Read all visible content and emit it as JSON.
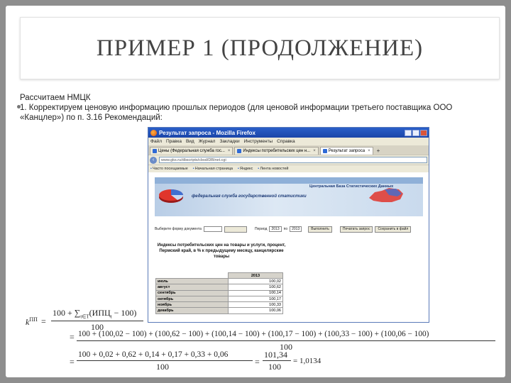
{
  "slide": {
    "title": "ПРИМЕР 1 (ПРОДОЛЖЕНИЕ)",
    "line1": "Рассчитаем НМЦК",
    "line2": "1. Корректируем ценовую информацию прошлых периодов (для ценовой информации третьего поставщика ООО «Канцлер») по п. 3.16 Рекомендаций:"
  },
  "browser": {
    "window_title": "Результат запроса - Mozilla Firefox",
    "menu": [
      "Файл",
      "Правка",
      "Вид",
      "Журнал",
      "Закладки",
      "Инструменты",
      "Справка"
    ],
    "tabs": [
      {
        "label": "Цены (Федеральная служба гос...",
        "active": false
      },
      {
        "label": "Индексы потребительских цен н...",
        "active": false
      },
      {
        "label": "Результат запроса",
        "active": true
      }
    ],
    "url": "www.gks.ru/dbscripts/cbsd/DBInet.cgi",
    "bookmarks": [
      "Часто посещаемые",
      "Начальная страница",
      "Яндекс",
      "Лента новостей"
    ],
    "banner": {
      "agency": "федеральная служба государственной статистики",
      "portal": "Центральная База Статистических Данных"
    },
    "form": {
      "choose_label": "Выберите форму документа",
      "period_label": "Период",
      "year_from": "2013",
      "to_label": "по",
      "year_to": "2013",
      "execute_button": "Выполнить",
      "print_button": "Печатать запрос",
      "save_button": "Сохранить в файл"
    },
    "table": {
      "title": "Индексы потребительских цен на товары и услуги, процент, Пермский край, в % к предыдущему месяцу, канцелярские товары",
      "year": "2013",
      "rows": [
        {
          "month": "июль",
          "value": "100,02"
        },
        {
          "month": "август",
          "value": "100,62"
        },
        {
          "month": "сентябрь",
          "value": "100,14"
        },
        {
          "month": "октябрь",
          "value": "100,17"
        },
        {
          "month": "ноябрь",
          "value": "100,33"
        },
        {
          "month": "декабрь",
          "value": "100,06"
        }
      ]
    }
  },
  "formula": {
    "lhs": "k",
    "lhs_sup": "ПП",
    "eq": "=",
    "frac1_num": "100 + ∑",
    "frac1_num_sub": "t∈T",
    "frac1_num_mid": "(ИПЦ",
    "frac1_num_sub2": "t",
    "frac1_num_end": " − 100)",
    "frac1_den": "100",
    "frac2_num": "100 + (100,02 − 100) + (100,62 − 100) + (100,14 − 100) + (100,17 − 100) + (100,33 − 100) + (100,06 − 100)",
    "frac2_den": "100",
    "frac3_num": "100 + 0,02 + 0,62 + 0,14 + 0,17 + 0,33 + 0,06",
    "frac3_den": "100",
    "frac4_num": "101,34",
    "frac4_den": "100",
    "result": "= 1,0134"
  }
}
